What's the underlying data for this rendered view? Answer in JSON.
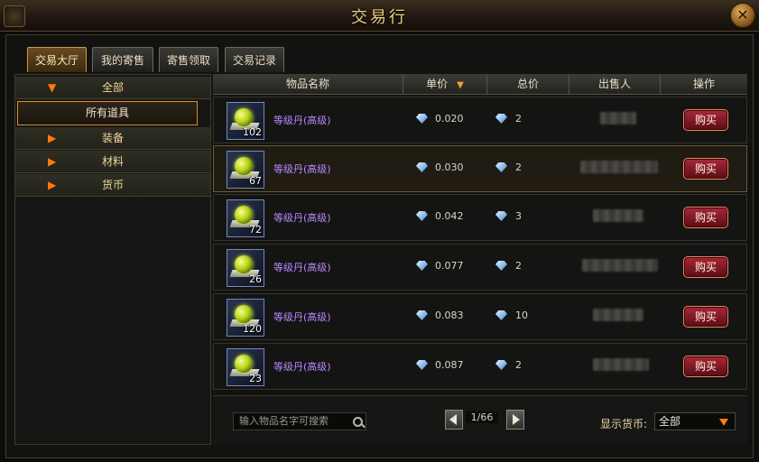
{
  "window": {
    "title": "交易行",
    "close_label": "✕"
  },
  "tabs": [
    {
      "label": "交易大厅",
      "active": true
    },
    {
      "label": "我的寄售"
    },
    {
      "label": "寄售领取"
    },
    {
      "label": "交易记录"
    }
  ],
  "sidebar": {
    "all_label": "全部",
    "selected_label": "所有道具",
    "categories": [
      "装备",
      "材料",
      "货币"
    ]
  },
  "table": {
    "headers": {
      "name": "物品名称",
      "unit_price": "单价",
      "total_price": "总价",
      "seller": "出售人",
      "action": "操作"
    },
    "buy_label": "购买",
    "rows": [
      {
        "name": "等级丹(高级)",
        "qty": "102",
        "unit_price": "0.020",
        "total": "2"
      },
      {
        "name": "等级丹(高级)",
        "qty": "67",
        "unit_price": "0.030",
        "total": "2"
      },
      {
        "name": "等级丹(高级)",
        "qty": "72",
        "unit_price": "0.042",
        "total": "3"
      },
      {
        "name": "等级丹(高级)",
        "qty": "26",
        "unit_price": "0.077",
        "total": "2"
      },
      {
        "name": "等级丹(高级)",
        "qty": "120",
        "unit_price": "0.083",
        "total": "10"
      },
      {
        "name": "等级丹(高级)",
        "qty": "23",
        "unit_price": "0.087",
        "total": "2"
      }
    ]
  },
  "footer": {
    "search_placeholder": "输入物品名字可搜索",
    "page": "1/66",
    "currency_label": "显示货币:",
    "currency_value": "全部"
  }
}
